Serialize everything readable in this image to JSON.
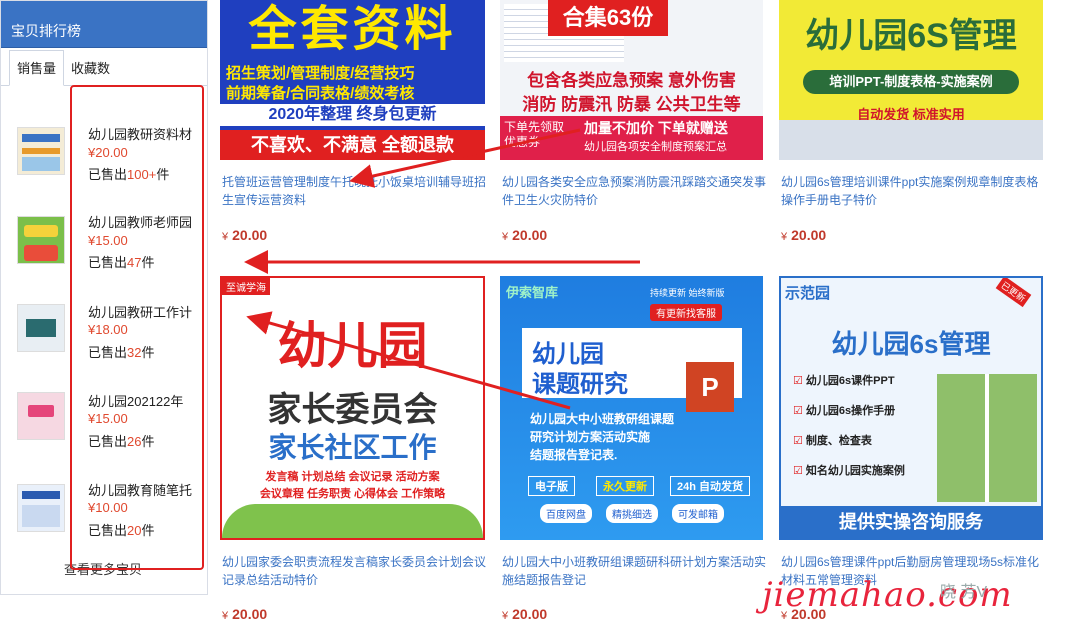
{
  "sidebar": {
    "title": "宝贝排行榜",
    "tabs": [
      "销售量",
      "收藏数"
    ],
    "more": "查看更多宝贝",
    "items": [
      {
        "title": "幼儿园教研资料材",
        "price": "¥20.00",
        "sold_prefix": "已售出",
        "sold_num": "100+",
        "sold_suffix": "件"
      },
      {
        "title": "幼儿园教师老师园",
        "price": "¥15.00",
        "sold_prefix": "已售出",
        "sold_num": "47",
        "sold_suffix": "件"
      },
      {
        "title": "幼儿园教研工作计",
        "price": "¥18.00",
        "sold_prefix": "已售出",
        "sold_num": "32",
        "sold_suffix": "件"
      },
      {
        "title": "幼儿园202122年",
        "price": "¥15.00",
        "sold_prefix": "已售出",
        "sold_num": "26",
        "sold_suffix": "件"
      },
      {
        "title": "幼儿园教育随笔托",
        "price": "¥10.00",
        "sold_prefix": "已售出",
        "sold_num": "20",
        "sold_suffix": "件"
      }
    ]
  },
  "products": [
    {
      "title": "托管班运营管理制度午托晚托小饭桌培训辅导班招生宣传运营资料",
      "currency": "¥",
      "price": "20.00",
      "img": {
        "line1": "全套资料",
        "line2": "招生策划/管理制度/经营技巧",
        "line3": "前期筹备/合同表格/绩效考核",
        "line4": "2020年整理 终身包更新",
        "line5": "不喜欢、不满意 全额退款"
      }
    },
    {
      "title": "幼儿园各类安全应急预案消防震汛踩踏交通突发事件卫生火灾防特价",
      "currency": "¥",
      "price": "20.00",
      "img": {
        "badge": "合集63份",
        "line1": "包含各类应急预案 意外伤害",
        "line2": "消防 防震汛 防暴 公共卫生等",
        "line3": "加量不加价 下单就赠送",
        "line4": "幼儿园各项安全制度预案汇总",
        "coupon": "下单先领取 优惠券"
      }
    },
    {
      "title": "幼儿园6s管理培训课件ppt实施案例规章制度表格操作手册电子特价",
      "currency": "¥",
      "price": "20.00",
      "img": {
        "line1": "幼儿园6S管理",
        "line2": "培训PPT-制度表格-实施案例",
        "line3": "自动发货 标准实用"
      }
    },
    {
      "title": "幼儿园家委会职责流程发言稿家长委员会计划会议记录总结活动特价",
      "currency": "¥",
      "price": "20.00",
      "img": {
        "tag": "至诚学海",
        "line1": "幼儿园",
        "line2": "家长委员会",
        "line3": "家长社区工作",
        "line4": "发言稿 计划总结 会议记录 活动方案",
        "line5": "会议章程 任务职责 心得体会 工作策略"
      }
    },
    {
      "title": "幼儿园大中小班教研组课题研科研计划方案活动实施结题报告登记",
      "currency": "¥",
      "price": "20.00",
      "img": {
        "brand": "伊索智库",
        "brand_tag": "持续更新 始终新版",
        "service": "有更新找客服",
        "line1": "幼儿园",
        "line2": "课题研究",
        "line3": "幼儿园大中小班教研组课题",
        "line4": "研究计划方案活动实施",
        "line5": "结题报告登记表.",
        "pill1": "电子版",
        "pill2": "永久更新",
        "pill3": "24h 自动发货",
        "pill4": "百度网盘",
        "pill5": "精挑细选",
        "pill6": "可发邮箱"
      }
    },
    {
      "title": "幼儿园6s管理课件ppt后勤厨房管理现场5s标准化材料五常管理资料",
      "currency": "¥",
      "price": "20.00",
      "img": {
        "tag": "示范园",
        "corner": "已更新",
        "line1": "幼儿园6s管理",
        "items": [
          "幼儿园6s课件PPT",
          "幼儿园6s操作手册",
          "制度、检查表",
          "知名幼儿园实施案例"
        ],
        "footer": "提供实操咨询服务"
      }
    }
  ],
  "watermark": {
    "main": "jiemahao.com",
    "small": "晓 芳V"
  },
  "colors": {
    "accent_blue": "#3a73c4",
    "price_red": "#c0392b",
    "annot_red": "#e02020"
  }
}
